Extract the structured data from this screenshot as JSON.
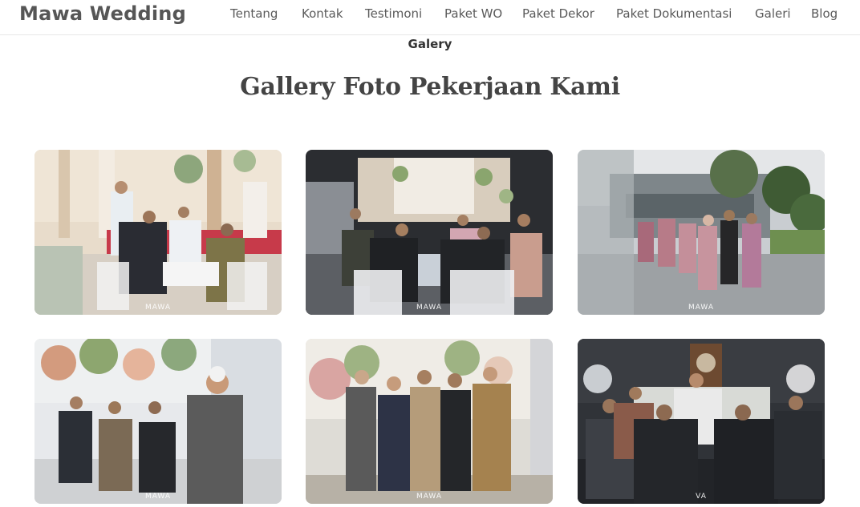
{
  "brand": "Mawa Wedding",
  "nav": [
    "Tentang",
    "Kontak",
    "Testimoni",
    "Paket WO",
    "Paket Dekor",
    "Paket Dokumentasi",
    "Galeri",
    "Blog"
  ],
  "section": {
    "eyebrow": "Galery",
    "title": "Gallery Foto Pekerjaan Kami"
  },
  "gallery": [
    {
      "watermark": "MAWA"
    },
    {
      "watermark": "MAWA"
    },
    {
      "watermark": "MAWA"
    },
    {
      "watermark": "MAWA"
    },
    {
      "watermark": "MAWA"
    },
    {
      "watermark": "VA"
    }
  ],
  "colors": {
    "text_dark": "#3d3d3d",
    "nav_text": "#5a5a5a",
    "divider": "#e6e6e6"
  }
}
